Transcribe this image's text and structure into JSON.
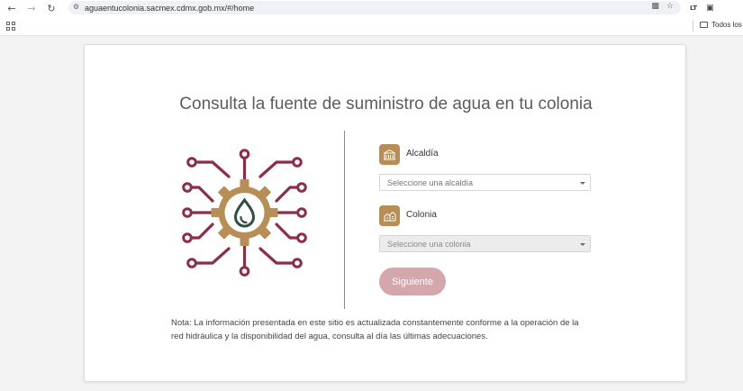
{
  "browser": {
    "url": "aguaentucolonia.sacmex.cdmx.gob.mx/#/home",
    "bookmark_folder": "Todos los",
    "extension_badge": "LT"
  },
  "page": {
    "title": "Consulta la fuente de suministro de agua en tu colonia",
    "alcaldia": {
      "label": "Alcaldía",
      "placeholder": "Seleccione una alcaldía"
    },
    "colonia": {
      "label": "Colonia",
      "placeholder": "Seleccione una colonia"
    },
    "submit_label": "Siguiente",
    "note_line1": "Nota: La información presentada en este sitio es actualizada constantemente conforme a la operación de la",
    "note_line2": "red hidráulica y la disponibilidad del agua, consulta al día las últimas adecuaciones."
  },
  "colors": {
    "brand_red": "#8a2f47",
    "brand_gold": "#b68e56",
    "brand_green": "#2f4f43",
    "button_bg": "#d4a7ad"
  }
}
